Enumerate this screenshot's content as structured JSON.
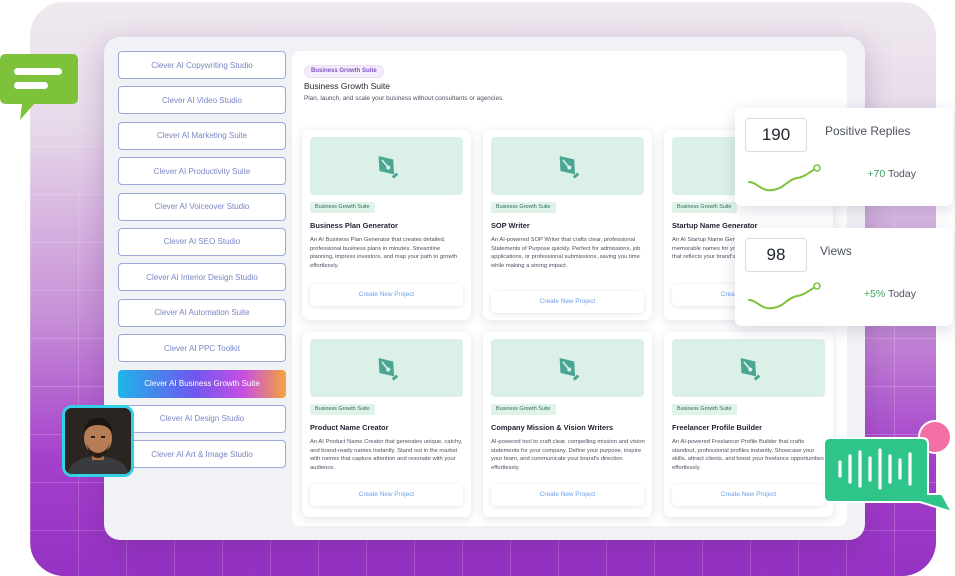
{
  "sidebar": {
    "items": [
      {
        "label": "Clever AI Copywriting Studio",
        "active": false
      },
      {
        "label": "Clever AI Video Studio",
        "active": false
      },
      {
        "label": "Clever AI Marketing Suite",
        "active": false
      },
      {
        "label": "Clever AI Productivity Suite",
        "active": false
      },
      {
        "label": "Clever AI Voiceover Studio",
        "active": false
      },
      {
        "label": "Clever AI SEO Studio",
        "active": false
      },
      {
        "label": "Clever AI Interior Design Studio",
        "active": false
      },
      {
        "label": "Clever AI Automation Suite",
        "active": false
      },
      {
        "label": "Clever AI PPC Toolkit",
        "active": false
      },
      {
        "label": "Clever AI Business Growth Suite",
        "active": true
      },
      {
        "label": "Clever AI Design Studio",
        "active": false
      },
      {
        "label": "Clever AI Art & Image Studio",
        "active": false
      }
    ]
  },
  "main": {
    "badge": "Business Growth Suite",
    "title": "Business Growth Suite",
    "description": "Plan, launch, and scale your business without consultants or agencies.",
    "cards": [
      {
        "badge": "Business Growth Suite",
        "title": "Business Plan Generator",
        "description": "An AI Business Plan Generator that creates detailed, professional business plans in minutes. Streamline planning, impress investors, and map your path to growth effortlessly.",
        "button": "Create New Project",
        "icon": "pen-nib-icon"
      },
      {
        "badge": "Business Growth Suite",
        "title": "SOP Writer",
        "description": "An AI-powered SOP Writer that crafts clear, professional Statements of Purpose quickly. Perfect for admissions, job applications, or professional submissions, saving you time while making a strong impact.",
        "button": "Create New Project",
        "icon": "pen-nib-icon"
      },
      {
        "badge": "Business Growth Suite",
        "title": "Startup Name Generator",
        "description": "An AI Startup Name Generator that creates unique, memorable names for your venture. Find the perfect name that reflects your brand's vision and stands out.",
        "button": "Create New Project",
        "icon": "pen-nib-icon"
      },
      {
        "badge": "Business Growth Suite",
        "title": "Product Name Creator",
        "description": "An AI Product Name Creator that generates unique, catchy, and brand-ready names instantly. Stand out in the market with names that capture attention and resonate with your audience.",
        "button": "Create New Project",
        "icon": "pen-nib-icon"
      },
      {
        "badge": "Business Growth Suite",
        "title": "Company Mission & Vision Writers",
        "description": "AI-powered tool to craft clear, compelling mission and vision statements for your company. Define your purpose, inspire your team, and communicate your brand's direction effortlessly.",
        "button": "Create New Project",
        "icon": "pen-nib-icon"
      },
      {
        "badge": "Business Growth Suite",
        "title": "Freelancer Profile Builder",
        "description": "An AI-powered Freelancer Profile Builder that crafts standout, professional profiles instantly. Showcase your skills, attract clients, and boost your freelance opportunities effortlessly.",
        "button": "Create New Project",
        "icon": "pen-nib-icon"
      }
    ]
  },
  "stats": [
    {
      "value": "190",
      "label": "Positive Replies",
      "delta": "+70",
      "period": "Today"
    },
    {
      "value": "98",
      "label": "Views",
      "delta": "+5%",
      "period": "Today"
    }
  ],
  "colors": {
    "accent_green": "#38a45d",
    "thumb_bg": "#dbf1e8",
    "pen_icon": "#4aa593",
    "sidebar_border": "#9ea8d8",
    "active_gradient": [
      "#1fb5e8",
      "#6e57f0",
      "#c84fe2",
      "#f6a43c"
    ]
  },
  "decor": {
    "chat_icon": "chat-bubble-icon",
    "voice_icon": "voice-waveform-icon",
    "avatar": "user-avatar"
  }
}
